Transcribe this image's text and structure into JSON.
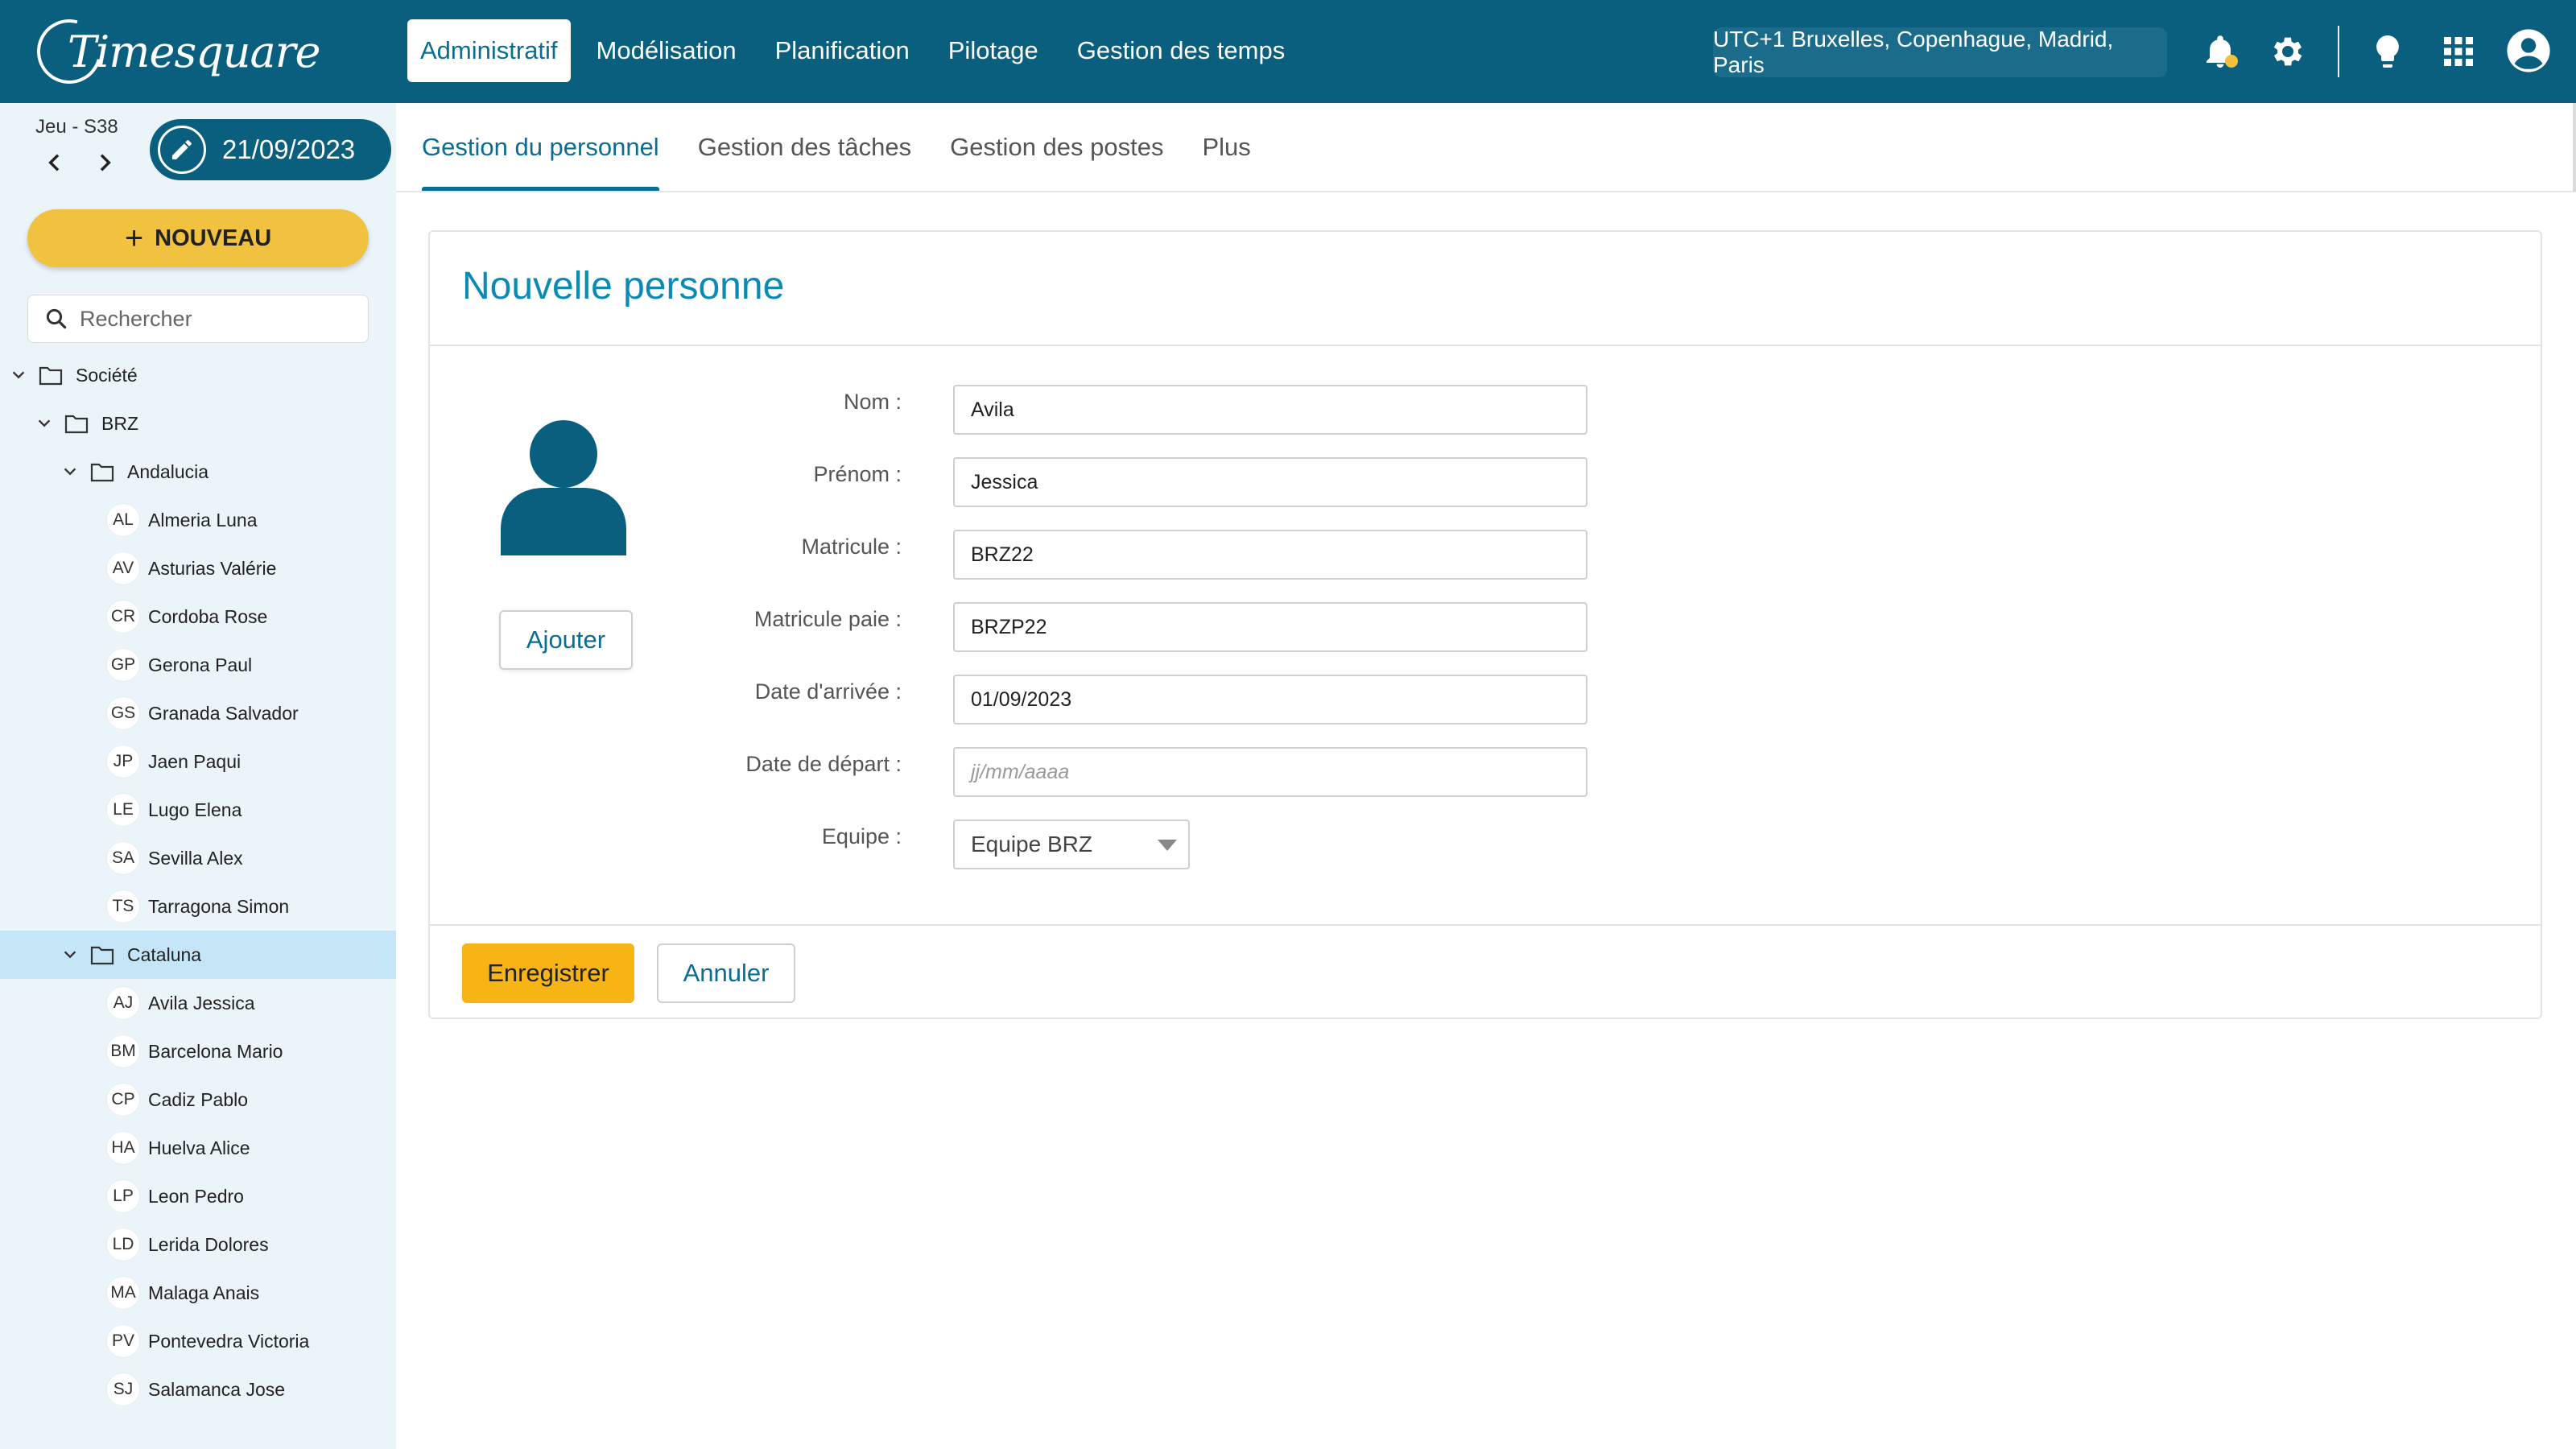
{
  "app": {
    "logo_text": "Timesquare"
  },
  "topnav": {
    "items": [
      {
        "label": "Administratif",
        "active": true
      },
      {
        "label": "Modélisation"
      },
      {
        "label": "Planification"
      },
      {
        "label": "Pilotage"
      },
      {
        "label": "Gestion des temps"
      }
    ],
    "timezone": "UTC+1 Bruxelles, Copenhague, Madrid, Paris",
    "icons": [
      "bell-icon",
      "gear-icon",
      "lightbulb-icon",
      "apps-grid-icon",
      "user-account-icon"
    ],
    "accent_color": "#0a5f7f",
    "notification_dot_color": "#f3c13a"
  },
  "datebar": {
    "day_label": "Jeu - S38",
    "date": "21/09/2023"
  },
  "subnav": {
    "tabs": [
      {
        "label": "Gestion du personnel",
        "active": true
      },
      {
        "label": "Gestion des tâches"
      },
      {
        "label": "Gestion des postes"
      },
      {
        "label": "Plus"
      }
    ]
  },
  "sidebar": {
    "new_button": "NOUVEAU",
    "search_placeholder": "Rechercher",
    "tree": [
      {
        "type": "folder",
        "label": "Société",
        "depth": 0,
        "expanded": true
      },
      {
        "type": "folder",
        "label": "BRZ",
        "depth": 1,
        "expanded": true
      },
      {
        "type": "folder",
        "label": "Andalucia",
        "depth": 2,
        "expanded": true
      },
      {
        "type": "person",
        "initials": "AL",
        "label": "Almeria Luna"
      },
      {
        "type": "person",
        "initials": "AV",
        "label": "Asturias Valérie"
      },
      {
        "type": "person",
        "initials": "CR",
        "label": "Cordoba Rose"
      },
      {
        "type": "person",
        "initials": "GP",
        "label": "Gerona Paul"
      },
      {
        "type": "person",
        "initials": "GS",
        "label": "Granada Salvador"
      },
      {
        "type": "person",
        "initials": "JP",
        "label": "Jaen Paqui"
      },
      {
        "type": "person",
        "initials": "LE",
        "label": "Lugo Elena"
      },
      {
        "type": "person",
        "initials": "SA",
        "label": "Sevilla Alex"
      },
      {
        "type": "person",
        "initials": "TS",
        "label": "Tarragona Simon"
      },
      {
        "type": "folder",
        "label": "Cataluna",
        "depth": 2,
        "expanded": true,
        "selected": true
      },
      {
        "type": "person",
        "initials": "AJ",
        "label": "Avila Jessica"
      },
      {
        "type": "person",
        "initials": "BM",
        "label": "Barcelona Mario"
      },
      {
        "type": "person",
        "initials": "CP",
        "label": "Cadiz Pablo"
      },
      {
        "type": "person",
        "initials": "HA",
        "label": "Huelva Alice"
      },
      {
        "type": "person",
        "initials": "LP",
        "label": "Leon Pedro"
      },
      {
        "type": "person",
        "initials": "LD",
        "label": "Lerida Dolores"
      },
      {
        "type": "person",
        "initials": "MA",
        "label": "Malaga Anais"
      },
      {
        "type": "person",
        "initials": "PV",
        "label": "Pontevedra Victoria"
      },
      {
        "type": "person",
        "initials": "SJ",
        "label": "Salamanca Jose"
      }
    ]
  },
  "form": {
    "title": "Nouvelle personne",
    "add_photo_label": "Ajouter",
    "fields": [
      {
        "label": "Nom :",
        "value": "Avila"
      },
      {
        "label": "Prénom :",
        "value": "Jessica"
      },
      {
        "label": "Matricule :",
        "value": "BRZ22"
      },
      {
        "label": "Matricule paie :",
        "value": "BRZP22"
      },
      {
        "label": "Date d'arrivée :",
        "value": "01/09/2023"
      },
      {
        "label": "Date de départ :",
        "value": "",
        "placeholder": "jj/mm/aaaa"
      }
    ],
    "team": {
      "label": "Equipe :",
      "value": "Equipe BRZ"
    },
    "save_label": "Enregistrer",
    "cancel_label": "Annuler"
  }
}
